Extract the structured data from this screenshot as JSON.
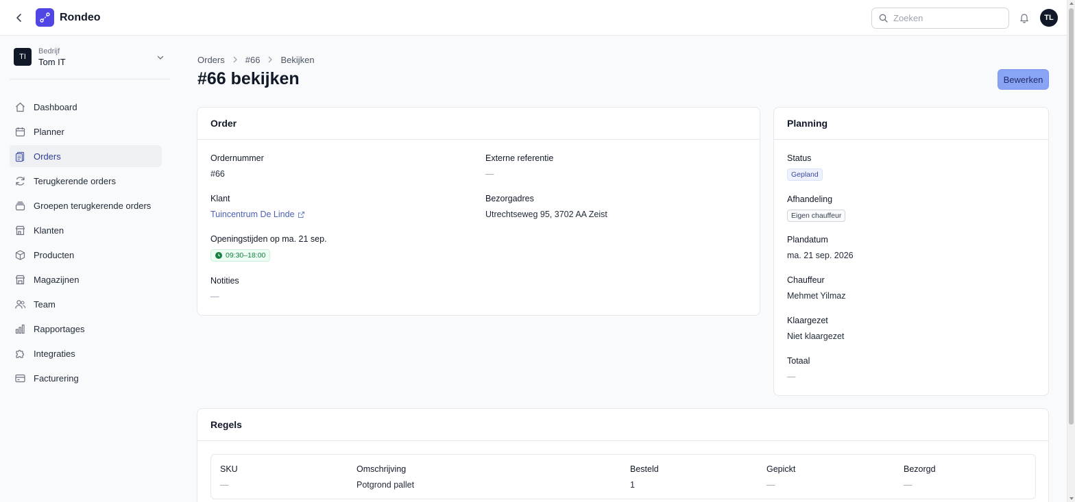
{
  "app": {
    "name": "Rondeo"
  },
  "header": {
    "search_placeholder": "Zoeken",
    "user_initials": "TL"
  },
  "company": {
    "initials": "TI",
    "label": "Bedrijf",
    "name": "Tom IT"
  },
  "sidebar": {
    "items": [
      {
        "label": "Dashboard",
        "icon": "home-icon"
      },
      {
        "label": "Planner",
        "icon": "calendar-icon"
      },
      {
        "label": "Orders",
        "icon": "clipboard-icon",
        "active": true
      },
      {
        "label": "Terugkerende orders",
        "icon": "refresh-icon"
      },
      {
        "label": "Groepen terugkerende orders",
        "icon": "stack-icon"
      },
      {
        "label": "Klanten",
        "icon": "store-icon"
      },
      {
        "label": "Producten",
        "icon": "box-icon"
      },
      {
        "label": "Magazijnen",
        "icon": "warehouse-icon"
      },
      {
        "label": "Team",
        "icon": "users-icon"
      },
      {
        "label": "Rapportages",
        "icon": "chart-icon"
      },
      {
        "label": "Integraties",
        "icon": "puzzle-icon"
      },
      {
        "label": "Facturering",
        "icon": "credit-card-icon"
      }
    ]
  },
  "breadcrumb": {
    "orders": "Orders",
    "order": "#66",
    "current": "Bekijken"
  },
  "page": {
    "title": "#66 bekijken",
    "edit_label": "Bewerken"
  },
  "order_card": {
    "title": "Order",
    "ordernummer_label": "Ordernummer",
    "ordernummer": "#66",
    "externe_ref_label": "Externe referentie",
    "externe_ref": "—",
    "klant_label": "Klant",
    "klant": "Tuincentrum De Linde",
    "bezorgadres_label": "Bezorgadres",
    "bezorgadres": "Utrechtseweg 95, 3702 AA Zeist",
    "openingstijden_label": "Openingstijden op ma. 21 sep.",
    "openingstijden": "09:30–18:00",
    "notities_label": "Notities",
    "notities": "—"
  },
  "planning_card": {
    "title": "Planning",
    "status_label": "Status",
    "status": "Gepland",
    "afhandeling_label": "Afhandeling",
    "afhandeling": "Eigen chauffeur",
    "plandatum_label": "Plandatum",
    "plandatum": "ma. 21 sep. 2026",
    "chauffeur_label": "Chauffeur",
    "chauffeur": "Mehmet Yilmaz",
    "klaargezet_label": "Klaargezet",
    "klaargezet": "Niet klaargezet",
    "totaal_label": "Totaal",
    "totaal": "—"
  },
  "regels_card": {
    "title": "Regels",
    "columns": [
      "SKU",
      "Omschrijving",
      "Besteld",
      "Gepickt",
      "Bezorgd"
    ],
    "rows": [
      [
        "—",
        "Potgrond pallet",
        "1",
        "—",
        "—"
      ]
    ]
  },
  "colors": {
    "accent": "#4f46e5",
    "button": "#8aa4f5",
    "link": "#4a5eb5"
  }
}
